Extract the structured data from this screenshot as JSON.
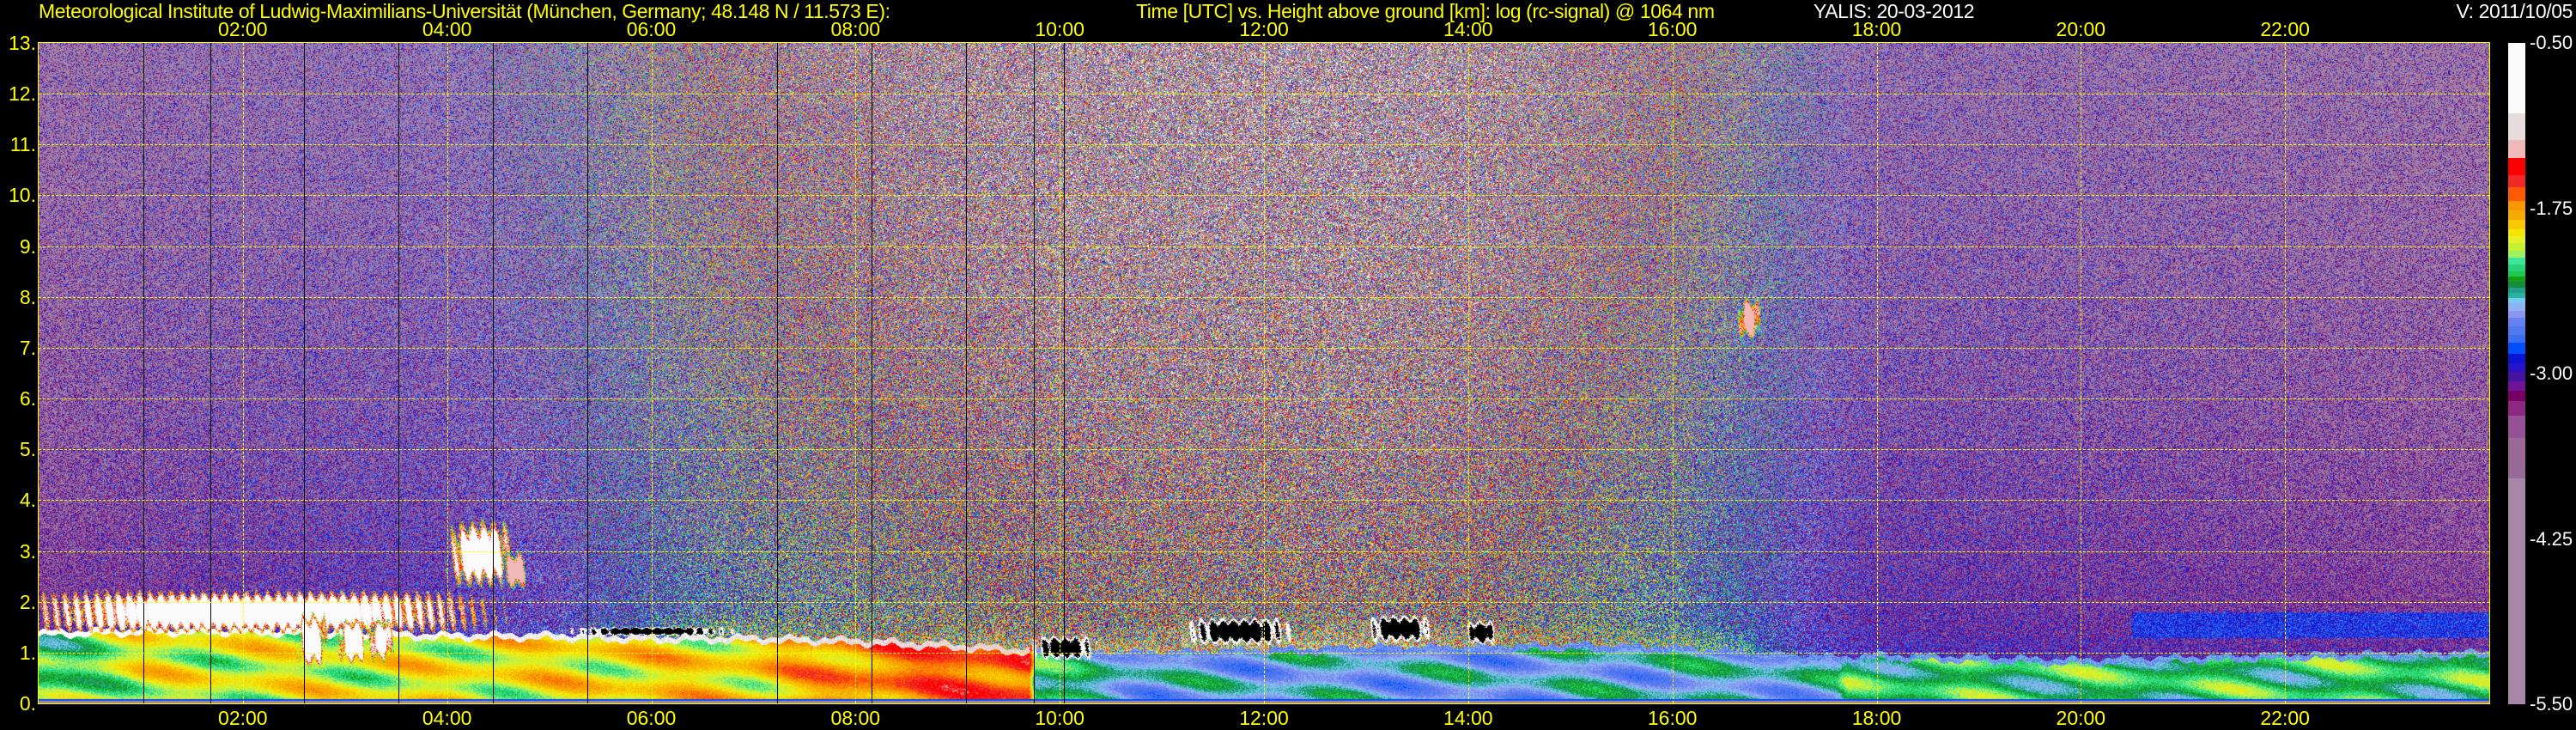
{
  "header": {
    "institute": "Meteorological Institute of Ludwig-Maximilians-Universität (München, Germany; 48.148 N / 11.573 E):",
    "description": "Time [UTC] vs. Height above ground [km]: log (rc-signal) @ 1064 nm",
    "instrument_date": "YALIS: 20-03-2012",
    "version": "V: 2011/10/05"
  },
  "chart_data": {
    "type": "heatmap",
    "title": "Time [UTC] vs. Height above ground [km]: log (rc-signal) @ 1064 nm",
    "xlabel": "Time [UTC]",
    "ylabel": "Height above ground [km]",
    "xlim_hours": [
      0,
      24
    ],
    "ylim_km": [
      0,
      13
    ],
    "grid": true,
    "x_ticks": [
      {
        "hour": 2,
        "label": "02:00"
      },
      {
        "hour": 4,
        "label": "04:00"
      },
      {
        "hour": 6,
        "label": "06:00"
      },
      {
        "hour": 8,
        "label": "08:00"
      },
      {
        "hour": 10,
        "label": "10:00"
      },
      {
        "hour": 12,
        "label": "12:00"
      },
      {
        "hour": 14,
        "label": "14:00"
      },
      {
        "hour": 16,
        "label": "16:00"
      },
      {
        "hour": 18,
        "label": "18:00"
      },
      {
        "hour": 20,
        "label": "20:00"
      },
      {
        "hour": 22,
        "label": "22:00"
      }
    ],
    "y_ticks": [
      {
        "km": 0,
        "label": "0."
      },
      {
        "km": 1,
        "label": "1."
      },
      {
        "km": 2,
        "label": "2."
      },
      {
        "km": 3,
        "label": "3."
      },
      {
        "km": 4,
        "label": "4."
      },
      {
        "km": 5,
        "label": "5."
      },
      {
        "km": 6,
        "label": "6."
      },
      {
        "km": 7,
        "label": "7."
      },
      {
        "km": 8,
        "label": "8."
      },
      {
        "km": 9,
        "label": "9."
      },
      {
        "km": 10,
        "label": "10."
      },
      {
        "km": 11,
        "label": "11."
      },
      {
        "km": 12,
        "label": "12."
      },
      {
        "km": 13,
        "label": "13."
      }
    ],
    "colorbar": {
      "range": [
        -5.5,
        -0.5
      ],
      "labels": [
        "-0.50",
        "-1.75",
        "-3.00",
        "-4.25",
        "-5.50"
      ],
      "label_values": [
        -0.5,
        -1.75,
        -3.0,
        -4.25,
        -5.5
      ],
      "segments": [
        {
          "top": -0.5,
          "color": "#fafafa"
        },
        {
          "top": -1.033,
          "color": "#e6dcdc"
        },
        {
          "top": -1.237,
          "color": "#f0b8b8"
        },
        {
          "top": -1.373,
          "color": "#ff0000"
        },
        {
          "top": -1.499,
          "color": "#f02828"
        },
        {
          "top": -1.594,
          "color": "#ff5a00"
        },
        {
          "top": -1.696,
          "color": "#fa9600"
        },
        {
          "top": -1.764,
          "color": "#f5aa00"
        },
        {
          "top": -1.838,
          "color": "#fac800"
        },
        {
          "top": -1.906,
          "color": "#f5e600"
        },
        {
          "top": -1.961,
          "color": "#e6f028"
        },
        {
          "top": -2.015,
          "color": "#c8f032"
        },
        {
          "top": -2.069,
          "color": "#a0f064"
        },
        {
          "top": -2.124,
          "color": "#3ce696"
        },
        {
          "top": -2.178,
          "color": "#28d278"
        },
        {
          "top": -2.226,
          "color": "#1ec850"
        },
        {
          "top": -2.266,
          "color": "#14a014"
        },
        {
          "top": -2.307,
          "color": "#148c3c"
        },
        {
          "top": -2.351,
          "color": "#1ea08c"
        },
        {
          "top": -2.389,
          "color": "#28b4a0"
        },
        {
          "top": -2.429,
          "color": "#78c8f0"
        },
        {
          "top": -2.47,
          "color": "#8cb4f0"
        },
        {
          "top": -2.525,
          "color": "#8c96f0"
        },
        {
          "top": -2.579,
          "color": "#6482f0"
        },
        {
          "top": -2.64,
          "color": "#5078f0"
        },
        {
          "top": -2.708,
          "color": "#3c6ef0"
        },
        {
          "top": -2.769,
          "color": "#0050ff"
        },
        {
          "top": -2.851,
          "color": "#0a14d2"
        },
        {
          "top": -2.919,
          "color": "#2814c8"
        },
        {
          "top": -2.987,
          "color": "#4614a0"
        },
        {
          "top": -3.061,
          "color": "#6e1496"
        },
        {
          "top": -3.129,
          "color": "#780064"
        },
        {
          "top": -3.211,
          "color": "#8c2882"
        },
        {
          "top": -3.319,
          "color": "#965096"
        },
        {
          "top": -3.489,
          "color": "#9a6a96"
        },
        {
          "top": -3.795,
          "color": "#a888a8"
        }
      ]
    },
    "boundary_layer_top_km": [
      [
        0,
        1.4
      ],
      [
        1,
        1.45
      ],
      [
        2,
        1.45
      ],
      [
        3,
        1.4
      ],
      [
        4,
        1.35
      ],
      [
        5,
        1.35
      ],
      [
        6,
        1.3
      ],
      [
        7,
        1.3
      ],
      [
        8,
        1.25
      ],
      [
        9,
        1.15
      ],
      [
        9.75,
        1.05
      ],
      [
        10,
        1.0
      ],
      [
        11,
        1.0
      ],
      [
        12,
        1.05
      ],
      [
        13,
        1.1
      ],
      [
        14,
        1.1
      ],
      [
        15,
        1.15
      ],
      [
        16,
        1.1
      ],
      [
        17,
        0.95
      ],
      [
        17.7,
        0.9
      ],
      [
        18,
        0.95
      ],
      [
        20,
        0.85
      ],
      [
        22,
        0.95
      ],
      [
        24,
        1.0
      ]
    ],
    "boundary_layer_signal": [
      [
        0,
        -2.25
      ],
      [
        1.03,
        -2.0
      ],
      [
        3,
        -2.0
      ],
      [
        5,
        -1.95
      ],
      [
        7,
        -1.9
      ],
      [
        8.2,
        -1.7
      ],
      [
        9.7,
        -1.6
      ],
      [
        9.76,
        -2.3
      ],
      [
        11,
        -2.5
      ],
      [
        14,
        -2.5
      ],
      [
        17.6,
        -2.45
      ],
      [
        17.7,
        -2.25
      ],
      [
        24,
        -2.25
      ]
    ],
    "layer_top_edge_signal": [
      [
        0,
        -0.8
      ],
      [
        9.7,
        -1.2
      ],
      [
        9.76,
        -2.6
      ],
      [
        17.6,
        -2.6
      ],
      [
        17.7,
        -2.55
      ],
      [
        24,
        -2.55
      ]
    ],
    "free_troposphere_signal": [
      [
        0,
        -3.3
      ],
      [
        5,
        -3.0
      ],
      [
        7,
        -2.6
      ],
      [
        10,
        -2.3
      ],
      [
        13,
        -2.2
      ],
      [
        16,
        -2.6
      ],
      [
        18,
        -3.1
      ],
      [
        24,
        -3.3
      ]
    ],
    "noise_amplitude": [
      [
        0,
        0.9
      ],
      [
        4,
        1.0
      ],
      [
        7,
        1.6
      ],
      [
        10,
        2.0
      ],
      [
        14,
        2.0
      ],
      [
        16,
        1.5
      ],
      [
        18,
        0.9
      ],
      [
        24,
        0.9
      ]
    ],
    "aerosol_bands": [
      {
        "t0": 20.5,
        "t1": 24,
        "h_km": 1.55,
        "thickness_km": 0.25,
        "signal": -2.85
      }
    ],
    "clouds": [
      {
        "t0": 0.05,
        "t1": 4.1,
        "h0": 1.45,
        "h1": 2.15,
        "signal": -0.6
      },
      {
        "t0": 2.55,
        "t1": 2.8,
        "h0": 0.8,
        "h1": 1.7,
        "signal": -0.7
      },
      {
        "t0": 2.95,
        "t1": 3.2,
        "h0": 0.85,
        "h1": 1.6,
        "signal": -0.7
      },
      {
        "t0": 3.25,
        "t1": 3.45,
        "h0": 0.9,
        "h1": 1.6,
        "signal": -0.8
      },
      {
        "t0": 4.05,
        "t1": 4.6,
        "h0": 2.4,
        "h1": 3.5,
        "signal": -0.8
      },
      {
        "t0": 4.55,
        "t1": 4.78,
        "h0": 2.3,
        "h1": 2.95,
        "signal": -1.3
      },
      {
        "t0": 16.65,
        "t1": 16.85,
        "h0": 7.2,
        "h1": 7.95,
        "signal": -1.3
      },
      {
        "t0": 9.78,
        "t1": 10.3,
        "h0": 0.9,
        "h1": 1.3,
        "signal": "saturated"
      },
      {
        "t0": 11.3,
        "t1": 12.2,
        "h0": 1.2,
        "h1": 1.65,
        "signal": "saturated"
      },
      {
        "t0": 13.05,
        "t1": 13.6,
        "h0": 1.25,
        "h1": 1.7,
        "signal": "saturated"
      },
      {
        "t0": 14.0,
        "t1": 14.25,
        "h0": 1.2,
        "h1": 1.6,
        "signal": "saturated"
      },
      {
        "t0": 5.3,
        "t1": 6.7,
        "h0": 1.35,
        "h1": 1.5,
        "signal": "saturated"
      }
    ],
    "data_gaps_hours": [
      1.03,
      1.68,
      2.6,
      3.52,
      4.45,
      5.37,
      7.23,
      8.16,
      9.08,
      9.75,
      10.04
    ]
  }
}
